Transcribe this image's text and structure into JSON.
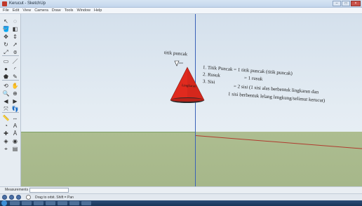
{
  "window": {
    "title": "Kerucut - SketchUp",
    "min": "–",
    "max": "□",
    "close": "×"
  },
  "menubar": [
    "File",
    "Edit",
    "View",
    "Camera",
    "Draw",
    "Tools",
    "Window",
    "Help"
  ],
  "toolbar": [
    {
      "name": "select-icon",
      "glyph": "↖"
    },
    {
      "name": "component-icon",
      "glyph": "◌"
    },
    {
      "name": "paint-bucket-icon",
      "glyph": "🪣"
    },
    {
      "name": "eraser-icon",
      "glyph": "◧"
    },
    {
      "name": "move-icon",
      "glyph": "✥"
    },
    {
      "name": "push-pull-icon",
      "glyph": "⇕"
    },
    {
      "name": "rotate-icon",
      "glyph": "↻"
    },
    {
      "name": "follow-me-icon",
      "glyph": "➚"
    },
    {
      "name": "scale-icon",
      "glyph": "⤢"
    },
    {
      "name": "offset-icon",
      "glyph": "⟃"
    },
    {
      "name": "rectangle-icon",
      "glyph": "▭"
    },
    {
      "name": "line-icon",
      "glyph": "／"
    },
    {
      "name": "circle-icon",
      "glyph": "●"
    },
    {
      "name": "arc-icon",
      "glyph": "◜"
    },
    {
      "name": "polygon-icon",
      "glyph": "⬟"
    },
    {
      "name": "freehand-icon",
      "glyph": "✎"
    },
    {
      "name": "orbit-icon",
      "glyph": "⟲"
    },
    {
      "name": "pan-icon",
      "glyph": "✋"
    },
    {
      "name": "zoom-icon",
      "glyph": "🔍"
    },
    {
      "name": "zoom-window-icon",
      "glyph": "⊕"
    },
    {
      "name": "previous-view-icon",
      "glyph": "◀"
    },
    {
      "name": "next-view-icon",
      "glyph": "▶"
    },
    {
      "name": "zoom-extents-icon",
      "glyph": "⤧"
    },
    {
      "name": "walk-icon",
      "glyph": "👣"
    },
    {
      "name": "tape-measure-icon",
      "glyph": "📏"
    },
    {
      "name": "dimension-icon",
      "glyph": "↔"
    },
    {
      "name": "protractor-icon",
      "glyph": "◔"
    },
    {
      "name": "text-icon",
      "glyph": "A"
    },
    {
      "name": "axes-icon",
      "glyph": "✚"
    },
    {
      "name": "3d-text-icon",
      "glyph": "Ā"
    },
    {
      "name": "section-plane-icon",
      "glyph": "◈"
    },
    {
      "name": "look-around-icon",
      "glyph": "◉"
    },
    {
      "name": "position-camera-icon",
      "glyph": "⌖"
    },
    {
      "name": "sandbox-icon",
      "glyph": "▤"
    }
  ],
  "annotations": {
    "apex_label": "titik puncak",
    "line1": "1. Titik Puncak = 1 titik puncak (titik puncak)",
    "line2_label": "2. Rusuk",
    "line2_value": "= 1 rusuk",
    "line3_label": "3. Sisi",
    "line3_value": "= 2 sisi (1 sisi alas berbentuk lingkaran  dan",
    "line4": "1 sisi berbentuk lelang lengkung/selimut kerucut)",
    "cone_label": "Lingkaran"
  },
  "measurements": {
    "label": "Measurements",
    "value": ""
  },
  "status": {
    "hint": "Drag to orbit.  Shift = Pan"
  },
  "colors": {
    "cone": "#e02a1e",
    "blue_axis": "#3a62b8",
    "red_axis": "#b03a2e",
    "ground": "#a6b78a",
    "sky": "#dce6f0"
  }
}
